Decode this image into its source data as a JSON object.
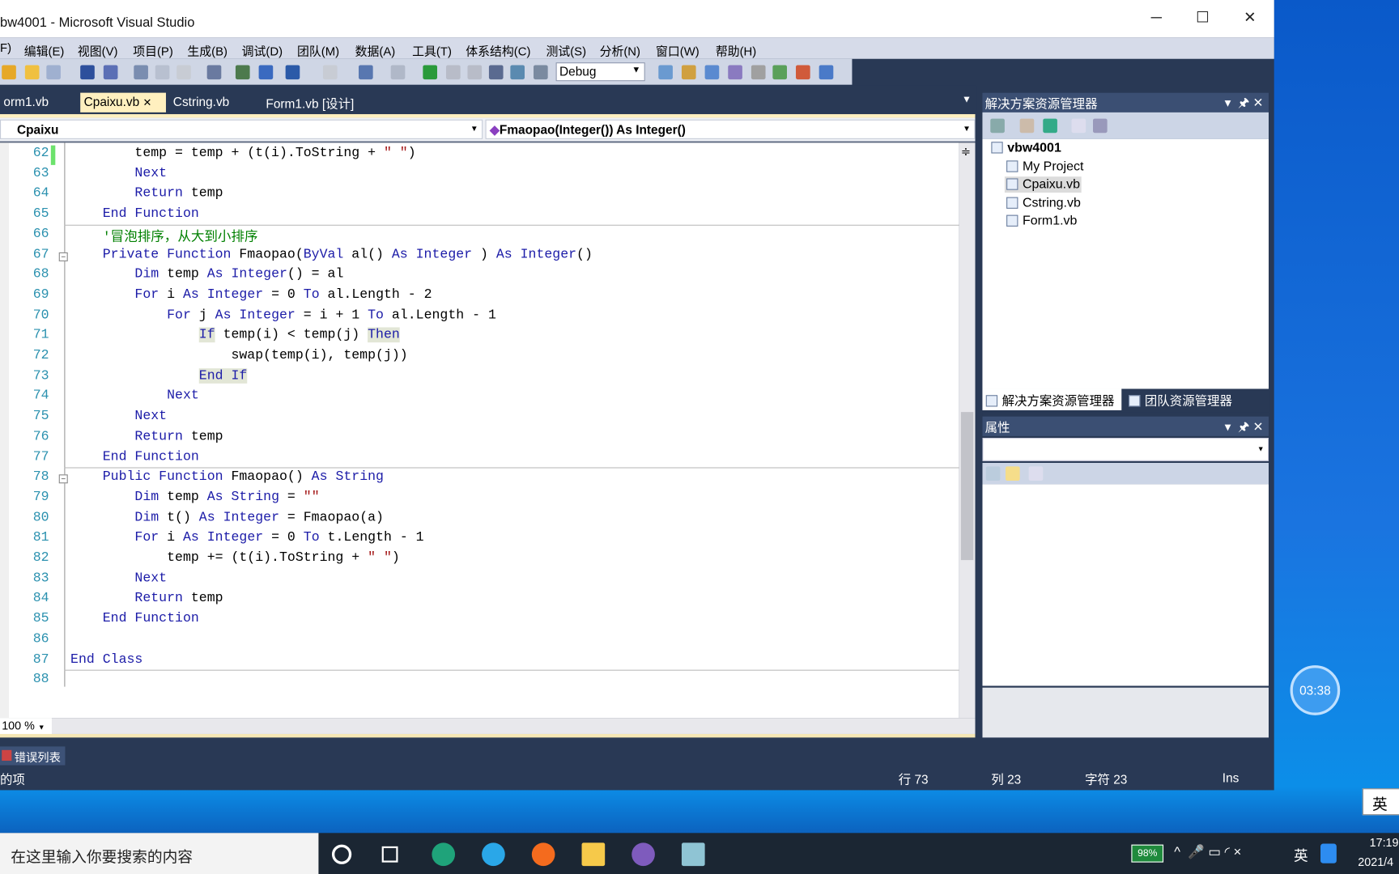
{
  "window": {
    "title": "bw4001 - Microsoft Visual Studio",
    "minimize": "─",
    "maximize": "☐",
    "close": "✕"
  },
  "menu": [
    "F)",
    "编辑(E)",
    "视图(V)",
    "项目(P)",
    "生成(B)",
    "调试(D)",
    "团队(M)",
    "数据(A)",
    "工具(T)",
    "体系结构(C)",
    "测试(S)",
    "分析(N)",
    "窗口(W)",
    "帮助(H)"
  ],
  "toolbar": {
    "config": "Debug"
  },
  "tabs": [
    {
      "label": "orm1.vb",
      "active": false
    },
    {
      "label": "Cpaixu.vb",
      "active": true,
      "close": "✕"
    },
    {
      "label": "Cstring.vb",
      "active": false
    },
    {
      "label": "Form1.vb [设计]",
      "active": false
    }
  ],
  "navbar": {
    "class": "Cpaixu",
    "member": "Fmaopao(Integer()) As Integer()"
  },
  "editor": {
    "lines": [
      {
        "n": "62",
        "t": [
          [
            "",
            "        temp = temp + (t(i).ToString + "
          ],
          [
            "str",
            "\" \""
          ],
          [
            "",
            ")"
          ]
        ]
      },
      {
        "n": "63",
        "t": [
          [
            "kw",
            "        Next"
          ]
        ]
      },
      {
        "n": "64",
        "t": [
          [
            "kw",
            "        Return"
          ],
          [
            "",
            " temp"
          ]
        ]
      },
      {
        "n": "65",
        "t": [
          [
            "kw",
            "    End Function"
          ]
        ]
      },
      {
        "n": "66",
        "t": [
          [
            "cm",
            "    '冒泡排序，从大到小排序"
          ]
        ]
      },
      {
        "n": "67",
        "t": [
          [
            "kw",
            "    Private Function"
          ],
          [
            "",
            " Fmaopao("
          ],
          [
            "kw",
            "ByVal"
          ],
          [
            "",
            " al() "
          ],
          [
            "kw",
            "As Integer"
          ],
          [
            "",
            " ) "
          ],
          [
            "kw",
            "As Integer"
          ],
          [
            "",
            "()"
          ]
        ]
      },
      {
        "n": "68",
        "t": [
          [
            "kw",
            "        Dim"
          ],
          [
            "",
            " temp "
          ],
          [
            "kw",
            "As Integer"
          ],
          [
            "",
            "() = al"
          ]
        ]
      },
      {
        "n": "69",
        "t": [
          [
            "kw",
            "        For"
          ],
          [
            "",
            " i "
          ],
          [
            "kw",
            "As Integer"
          ],
          [
            "",
            " = 0 "
          ],
          [
            "kw",
            "To"
          ],
          [
            "",
            " al.Length - 2"
          ]
        ]
      },
      {
        "n": "70",
        "t": [
          [
            "kw",
            "            For"
          ],
          [
            "",
            " j "
          ],
          [
            "kw",
            "As Integer"
          ],
          [
            "",
            " = i + 1 "
          ],
          [
            "kw",
            "To"
          ],
          [
            "",
            " al.Length - 1"
          ]
        ]
      },
      {
        "n": "71",
        "t": [
          [
            "",
            "                "
          ],
          [
            "kw hl",
            "If"
          ],
          [
            "",
            " temp(i) < temp(j) "
          ],
          [
            "kw hl",
            "Then"
          ]
        ]
      },
      {
        "n": "72",
        "t": [
          [
            "",
            "                    swap(temp(i), temp(j))"
          ]
        ]
      },
      {
        "n": "73",
        "t": [
          [
            "",
            "                "
          ],
          [
            "kw hl",
            "End If"
          ]
        ]
      },
      {
        "n": "74",
        "t": [
          [
            "kw",
            "            Next"
          ]
        ]
      },
      {
        "n": "75",
        "t": [
          [
            "kw",
            "        Next"
          ]
        ]
      },
      {
        "n": "76",
        "t": [
          [
            "kw",
            "        Return"
          ],
          [
            "",
            " temp"
          ]
        ]
      },
      {
        "n": "77",
        "t": [
          [
            "kw",
            "    End Function"
          ]
        ]
      },
      {
        "n": "78",
        "t": [
          [
            "kw",
            "    Public Function"
          ],
          [
            "",
            " Fmaopao() "
          ],
          [
            "kw",
            "As String"
          ]
        ]
      },
      {
        "n": "79",
        "t": [
          [
            "kw",
            "        Dim"
          ],
          [
            "",
            " temp "
          ],
          [
            "kw",
            "As String"
          ],
          [
            "",
            " = "
          ],
          [
            "str",
            "\"\""
          ]
        ]
      },
      {
        "n": "80",
        "t": [
          [
            "kw",
            "        Dim"
          ],
          [
            "",
            " t() "
          ],
          [
            "kw",
            "As Integer"
          ],
          [
            "",
            " = Fmaopao(a)"
          ]
        ]
      },
      {
        "n": "81",
        "t": [
          [
            "kw",
            "        For"
          ],
          [
            "",
            " i "
          ],
          [
            "kw",
            "As Integer"
          ],
          [
            "",
            " = 0 "
          ],
          [
            "kw",
            "To"
          ],
          [
            "",
            " t.Length - 1"
          ]
        ]
      },
      {
        "n": "82",
        "t": [
          [
            "",
            "            temp += (t(i).ToString + "
          ],
          [
            "str",
            "\" \""
          ],
          [
            "",
            ")"
          ]
        ]
      },
      {
        "n": "83",
        "t": [
          [
            "kw",
            "        Next"
          ]
        ]
      },
      {
        "n": "84",
        "t": [
          [
            "kw",
            "        Return"
          ],
          [
            "",
            " temp"
          ]
        ]
      },
      {
        "n": "85",
        "t": [
          [
            "kw",
            "    End Function"
          ]
        ]
      },
      {
        "n": "86",
        "t": []
      },
      {
        "n": "87",
        "t": [
          [
            "kw",
            "End Class"
          ]
        ]
      },
      {
        "n": "88",
        "t": []
      }
    ],
    "zoom": "100 %"
  },
  "solution_explorer": {
    "title": "解决方案资源管理器",
    "root": "vbw4001",
    "items": [
      "My Project",
      "Cpaixu.vb",
      "Cstring.vb",
      "Form1.vb"
    ],
    "selected": "Cpaixu.vb",
    "tab1": "解决方案资源管理器",
    "tab2": "团队资源管理器"
  },
  "properties": {
    "title": "属性"
  },
  "error_list": {
    "label": "错误列表"
  },
  "status": {
    "left": "的项",
    "line": "行 73",
    "col": "列 23",
    "char": "字符 23",
    "mode": "Ins"
  },
  "overlay": {
    "timer": "03:38",
    "ime": "英"
  },
  "taskbar": {
    "search_placeholder": "在这里输入你要搜索的内容",
    "battery": "98%",
    "ime": "英",
    "time": "17:19",
    "date": "2021/4"
  },
  "colors": {
    "keyword": "#1c1ca8",
    "string": "#a31515",
    "comment": "#008000",
    "line_number": "#2b91af",
    "chrome": "#293955"
  }
}
